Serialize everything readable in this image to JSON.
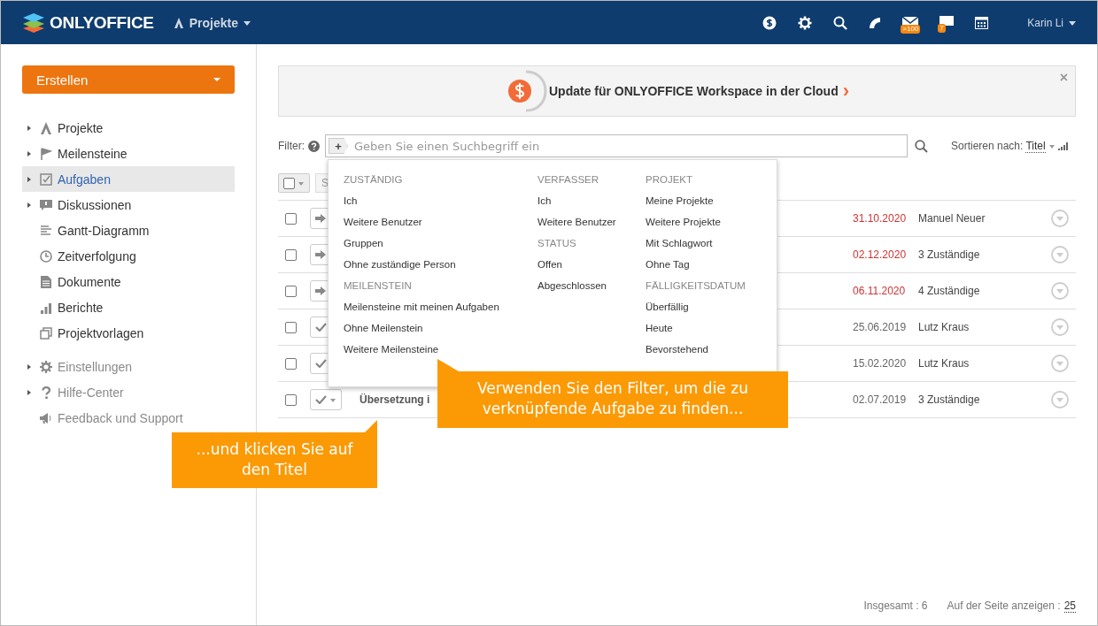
{
  "header": {
    "logo": "ONLYOFFICE",
    "module": "Projekte",
    "user": "Karin Li",
    "mail_badge": ">100",
    "chat_badge": "7"
  },
  "sidebar": {
    "create_button": "Erstellen",
    "items": [
      {
        "label": "Projekte",
        "expandable": true,
        "selected": false
      },
      {
        "label": "Meilensteine",
        "expandable": true,
        "selected": false
      },
      {
        "label": "Aufgaben",
        "expandable": true,
        "selected": true
      },
      {
        "label": "Diskussionen",
        "expandable": true,
        "selected": false
      },
      {
        "label": "Gantt-Diagramm",
        "expandable": false,
        "selected": false
      },
      {
        "label": "Zeitverfolgung",
        "expandable": false,
        "selected": false
      },
      {
        "label": "Dokumente",
        "expandable": false,
        "selected": false
      },
      {
        "label": "Berichte",
        "expandable": false,
        "selected": false
      },
      {
        "label": "Projektvorlagen",
        "expandable": false,
        "selected": false
      }
    ],
    "secondary": [
      {
        "label": "Einstellungen",
        "expandable": true
      },
      {
        "label": "Hilfe-Center",
        "expandable": true
      },
      {
        "label": "Feedback und Support",
        "expandable": false
      }
    ]
  },
  "banner": {
    "text": "Update für ONLYOFFICE Workspace in der Cloud",
    "arrow": "›",
    "close": "×"
  },
  "filter": {
    "label": "Filter:",
    "add": "+",
    "placeholder": "Geben Sie einen Suchbegriff ein",
    "sort_label": "Sortieren nach:",
    "sort_value": "Titel"
  },
  "toolbar": {
    "button": "S"
  },
  "filter_menu": [
    {
      "groups": [
        {
          "heading": "ZUSTÄNDIG",
          "items": [
            "Ich",
            "Weitere Benutzer",
            "Gruppen",
            "Ohne zuständige Person"
          ]
        },
        {
          "heading": "MEILENSTEIN",
          "items": [
            "Meilensteine mit meinen Aufgaben",
            "Ohne Meilenstein",
            "Weitere Meilensteine"
          ]
        }
      ]
    },
    {
      "groups": [
        {
          "heading": "VERFASSER",
          "items": [
            "Ich",
            "Weitere Benutzer"
          ]
        },
        {
          "heading": "STATUS",
          "items": [
            "Offen",
            "Abgeschlossen"
          ]
        }
      ]
    },
    {
      "groups": [
        {
          "heading": "PROJEKT",
          "items": [
            "Meine Projekte",
            "Weitere Projekte",
            "Mit Schlagwort",
            "Ohne Tag"
          ]
        },
        {
          "heading": "FÄLLIGKEITSDATUM",
          "items": [
            "Überfällig",
            "Heute",
            "Bevorstehend"
          ]
        }
      ]
    }
  ],
  "tasks": [
    {
      "kind": "open",
      "checked": false,
      "date": "31.10.2020",
      "overdue": true,
      "assignee": "Manuel Neuer"
    },
    {
      "kind": "open",
      "checked": false,
      "date": "02.12.2020",
      "overdue": true,
      "assignee": "3 Zuständige"
    },
    {
      "kind": "open",
      "checked": false,
      "date": "06.11.2020",
      "overdue": true,
      "assignee": "4 Zuständige"
    },
    {
      "kind": "closed",
      "checked": false,
      "date": "25.06.2019",
      "overdue": false,
      "assignee": "Lutz Kraus"
    },
    {
      "kind": "closed",
      "checked": false,
      "date": "15.02.2020",
      "overdue": false,
      "assignee": "Lutz Kraus"
    },
    {
      "kind": "closed",
      "checked": false,
      "title": "Übersetzung i",
      "date": "02.07.2019",
      "overdue": false,
      "assignee": "3 Zuständige"
    }
  ],
  "callouts": [
    "Verwenden Sie den Filter, um die zu verknüpfende Aufgabe zu finden...",
    "...und klicken Sie auf den Titel"
  ],
  "footer": {
    "total": "Insgesamt : 6",
    "per_page_label": "Auf der Seite anzeigen :",
    "per_page": "25"
  }
}
